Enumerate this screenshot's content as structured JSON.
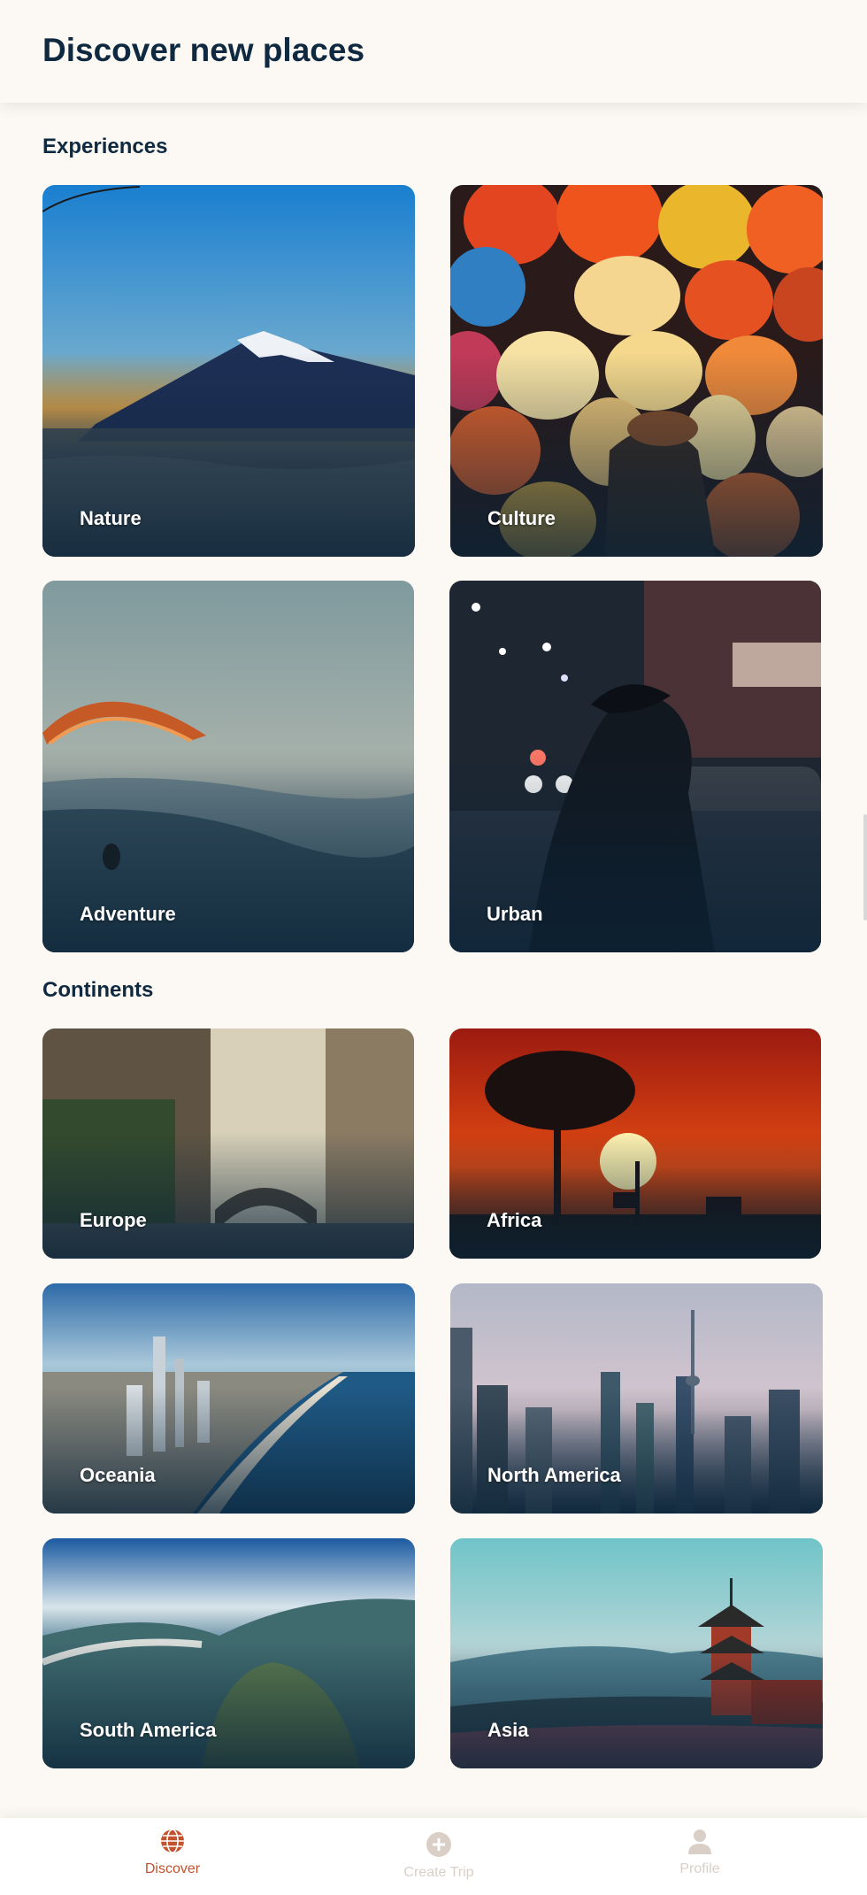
{
  "header": {
    "title": "Discover new places"
  },
  "experiences": {
    "title": "Experiences",
    "items": [
      {
        "label": "Nature"
      },
      {
        "label": "Culture"
      },
      {
        "label": "Adventure"
      },
      {
        "label": "Urban"
      }
    ]
  },
  "continents": {
    "title": "Continents",
    "items": [
      {
        "label": "Europe"
      },
      {
        "label": "Africa"
      },
      {
        "label": "Oceania"
      },
      {
        "label": "North America"
      },
      {
        "label": "South America"
      },
      {
        "label": "Asia"
      }
    ]
  },
  "nav": {
    "discover": "Discover",
    "create_trip": "Create Trip",
    "profile": "Profile"
  },
  "colors": {
    "background": "#fcf9f4",
    "heading": "#0f2a40",
    "accent": "#c2532e",
    "inactive_nav": "#d9cfc7"
  },
  "icons": {
    "discover": "globe-icon",
    "create_trip": "plus-circle-icon",
    "profile": "person-icon"
  }
}
